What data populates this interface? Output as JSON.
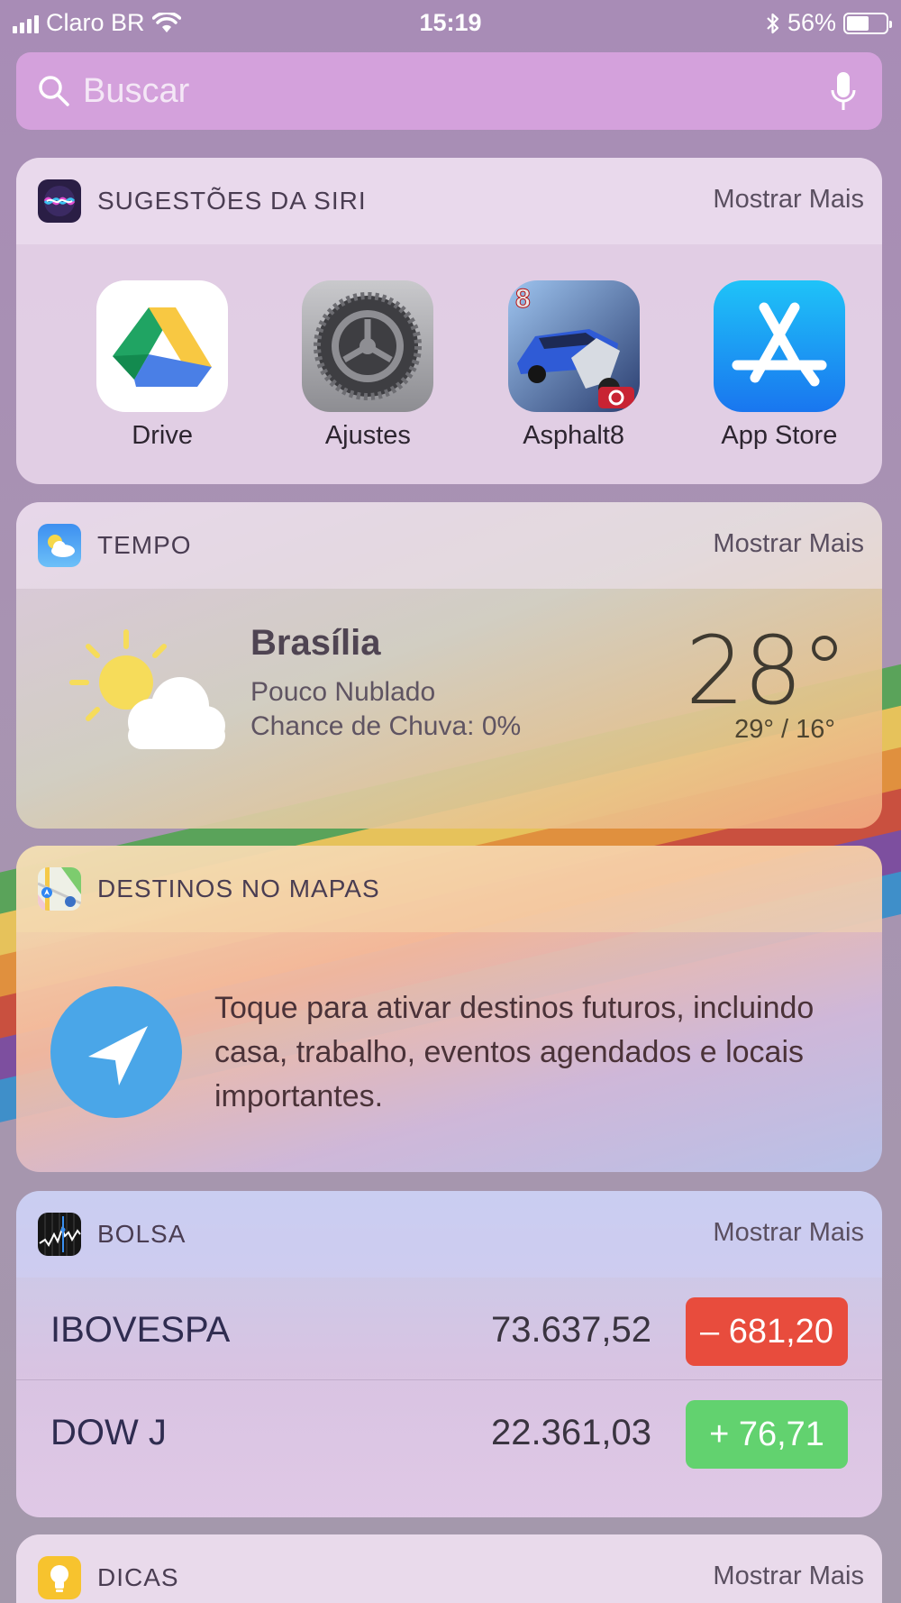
{
  "status_bar": {
    "carrier": "Claro BR",
    "time": "15:19",
    "battery_percent": "56%",
    "battery_level": 0.56
  },
  "search": {
    "placeholder": "Buscar"
  },
  "siri_widget": {
    "title": "SUGESTÕES DA SIRI",
    "more_label": "Mostrar Mais",
    "apps": [
      {
        "label": "Drive",
        "icon": "google-drive-icon"
      },
      {
        "label": "Ajustes",
        "icon": "settings-gear-icon"
      },
      {
        "label": "Asphalt8",
        "icon": "asphalt8-game-icon"
      },
      {
        "label": "App Store",
        "icon": "app-store-icon"
      }
    ]
  },
  "weather_widget": {
    "title": "TEMPO",
    "more_label": "Mostrar Mais",
    "city": "Brasília",
    "condition": "Pouco Nublado",
    "rain_chance": "Chance de Chuva: 0%",
    "temperature": "28°",
    "range": "29° / 16°"
  },
  "maps_widget": {
    "title": "DESTINOS NO MAPAS",
    "message": "Toque para ativar destinos futuros, incluindo casa, trabalho, eventos agendados e locais importantes."
  },
  "stocks_widget": {
    "title": "BOLSA",
    "more_label": "Mostrar Mais",
    "rows": [
      {
        "name": "IBOVESPA",
        "value": "73.637,52",
        "change": "– 681,20",
        "color": "#e84c3d"
      },
      {
        "name": "DOW J",
        "value": "22.361,03",
        "change": "+ 76,71",
        "color": "#62d26f"
      }
    ]
  },
  "tips_widget": {
    "title": "DICAS",
    "more_label": "Mostrar Mais"
  }
}
